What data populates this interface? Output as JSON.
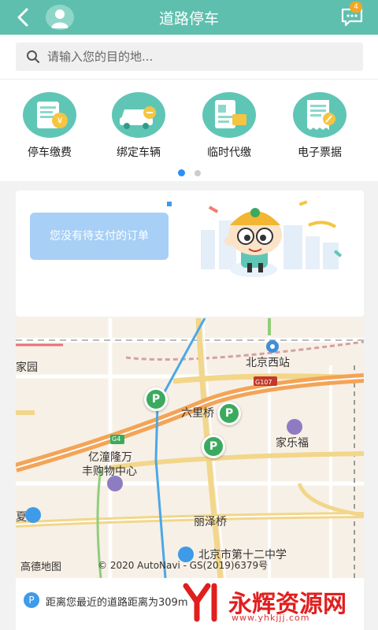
{
  "header": {
    "title": "道路停车",
    "badge_count": "4"
  },
  "search": {
    "placeholder": "请输入您的目的地..."
  },
  "services": [
    {
      "label": "停车缴费",
      "icon": "parking-payment-icon"
    },
    {
      "label": "绑定车辆",
      "icon": "bind-vehicle-icon"
    },
    {
      "label": "临时代缴",
      "icon": "temporary-payment-icon"
    },
    {
      "label": "电子票据",
      "icon": "e-receipt-icon"
    }
  ],
  "carousel": {
    "pages": 2,
    "active": 0
  },
  "order_card": {
    "message": "您没有待支付的订单"
  },
  "map": {
    "labels": {
      "jiayuan": "家园",
      "beijing_west": "北京西站",
      "liulichang": "六里桥",
      "jialefu": "家乐福",
      "yishang": "亿潼隆万",
      "fengshou": "丰购物中心",
      "lizeqiao": "丽泽桥",
      "school": "北京市第十二中学",
      "g107": "G107",
      "g4": "G4",
      "xia": "夏"
    },
    "logo": "高德地图",
    "copyright": "© 2020 AutoNavi - GS(2019)6379号",
    "pin_label": "P"
  },
  "bottom": {
    "text": "距离您最近的道路距离为309m",
    "badge": "P"
  },
  "watermark": {
    "text": "永辉资源网",
    "url": "www.yhkjjj.com"
  },
  "colors": {
    "primary": "#5fbfae",
    "pin": "#3caa5e",
    "accent": "#2a8ff7"
  }
}
